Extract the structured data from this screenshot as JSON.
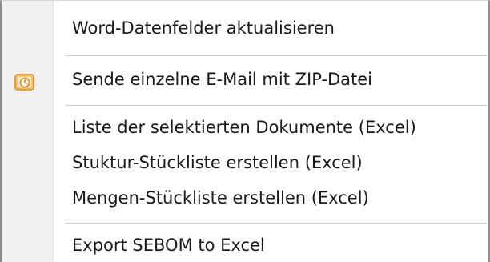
{
  "menu": {
    "items": [
      {
        "label": "Word-Datenfelder aktualisieren",
        "icon": null
      },
      {
        "label": "Sende einzelne E-Mail mit ZIP-Datei",
        "icon": "email-zip-icon"
      },
      {
        "label": "Liste der selektierten Dokumente (Excel)",
        "icon": null
      },
      {
        "label": "Stuktur-Stückliste erstellen (Excel)",
        "icon": null
      },
      {
        "label": "Mengen-Stückliste erstellen (Excel)",
        "icon": null
      },
      {
        "label": "Export SEBOM to Excel",
        "icon": null
      }
    ]
  },
  "colors": {
    "gutter": "#f1f1f1",
    "separator": "#cfcfcf",
    "border": "#8c8c8c",
    "icon_orange": "#f2a93b"
  }
}
